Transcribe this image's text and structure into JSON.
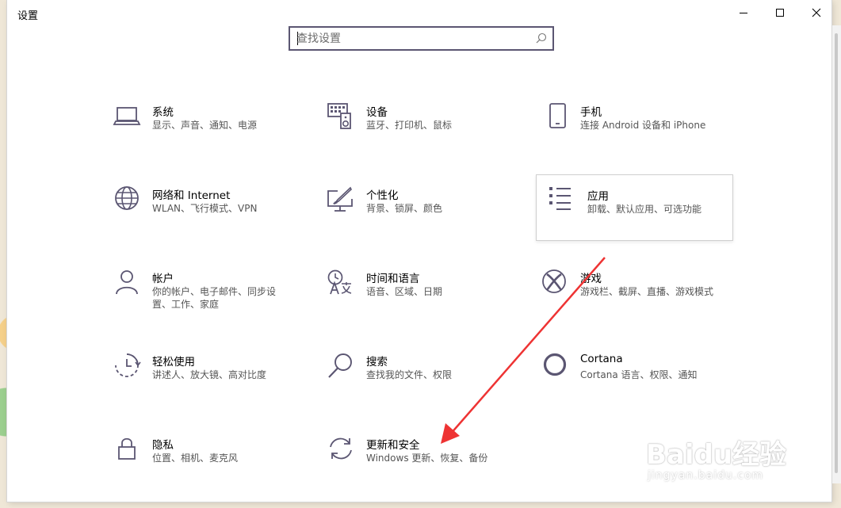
{
  "window": {
    "title": "设置"
  },
  "search": {
    "placeholder": "查找设置"
  },
  "tiles": [
    {
      "name": "系统",
      "desc": "显示、声音、通知、电源",
      "icon": "laptop-icon"
    },
    {
      "name": "设备",
      "desc": "蓝牙、打印机、鼠标",
      "icon": "keyboard-speaker-icon"
    },
    {
      "name": "手机",
      "desc": "连接 Android 设备和 iPhone",
      "icon": "phone-icon"
    },
    {
      "name": "网络和 Internet",
      "desc": "WLAN、飞行模式、VPN",
      "icon": "globe-icon"
    },
    {
      "name": "个性化",
      "desc": "背景、锁屏、颜色",
      "icon": "paint-screen-icon"
    },
    {
      "name": "应用",
      "desc": "卸载、默认应用、可选功能",
      "icon": "app-list-icon"
    },
    {
      "name": "帐户",
      "desc": "你的帐户、电子邮件、同步设置、工作、家庭",
      "icon": "person-icon"
    },
    {
      "name": "时间和语言",
      "desc": "语音、区域、日期",
      "icon": "time-language-icon"
    },
    {
      "name": "游戏",
      "desc": "游戏栏、截屏、直播、游戏模式",
      "icon": "xbox-icon"
    },
    {
      "name": "轻松使用",
      "desc": "讲述人、放大镜、高对比度",
      "icon": "ease-of-access-icon"
    },
    {
      "name": "搜索",
      "desc": "查找我的文件、权限",
      "icon": "search-icon"
    },
    {
      "name": "Cortana",
      "desc": "Cortana 语言、权限、通知",
      "icon": "cortana-ring-icon"
    },
    {
      "name": "隐私",
      "desc": "位置、相机、麦克风",
      "icon": "lock-icon"
    },
    {
      "name": "更新和安全",
      "desc": "Windows 更新、恢复、备份",
      "icon": "sync-icon"
    }
  ],
  "watermark": {
    "logo": "Baidu经验",
    "url": "jingyan.baidu.com"
  },
  "colors": {
    "accent": "#5b5672",
    "arrow": "#ee3333"
  }
}
